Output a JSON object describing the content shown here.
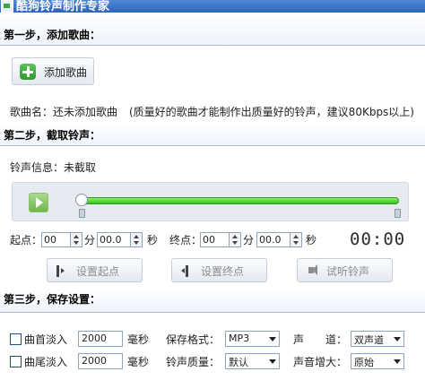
{
  "window": {
    "title": "酷狗铃声制作专家"
  },
  "step1": {
    "heading": "第一步，添加歌曲：",
    "add_song_label": "添加歌曲",
    "song_name_label": "歌曲名：",
    "song_name_value": "还未添加歌曲",
    "hint": "(质量好的歌曲才能制作出质量好的铃声，建议80Kbps以上)"
  },
  "step2": {
    "heading": "第二步，截取铃声：",
    "ringtone_info_label": "铃声信息：",
    "ringtone_info_value": "未截取",
    "start_label": "起点：",
    "end_label": "终点：",
    "start_min": "00",
    "start_sec": "00.0",
    "end_min": "00",
    "end_sec": "00.0",
    "min_unit": "分",
    "sec_unit": "秒",
    "timer": "00:00",
    "set_start_label": "设置起点",
    "set_end_label": "设置终点",
    "preview_label": "试听铃声"
  },
  "step3": {
    "heading": "第三步，保存设置：",
    "fade_in_label": "曲首淡入",
    "fade_in_value": "2000",
    "fade_out_label": "曲尾淡入",
    "fade_out_value": "2000",
    "ms_unit": "毫秒",
    "format_label": "保存格式：",
    "format_value": "MP3",
    "quality_label": "铃声质量：",
    "quality_value": "默认",
    "channel_label": "声　　道：",
    "channel_value": "双声道",
    "gain_label": "声音增大：",
    "gain_value": "原始"
  }
}
